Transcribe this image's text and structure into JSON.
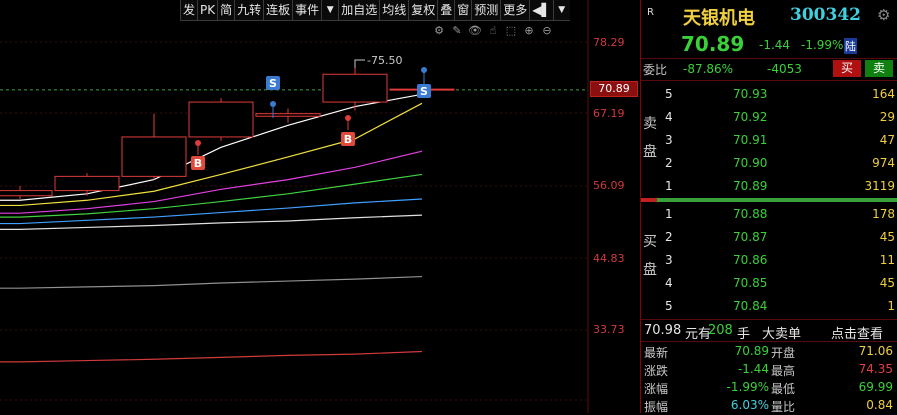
{
  "toolbar": {
    "items": [
      "发",
      "PK",
      "简",
      "九转",
      "连板",
      "事件",
      "▼",
      "加自选",
      "均线",
      "复权",
      "叠",
      "窗",
      "预测",
      "更多",
      "◀▌",
      "▼"
    ]
  },
  "chart": {
    "y_ticks": [
      "78.29",
      "67.19",
      "56.09",
      "44.83",
      "33.73"
    ],
    "current_price": "70.89",
    "high_label": "75.50",
    "markers": {
      "buy": "B",
      "sell": "S"
    },
    "tools": [
      "⚙",
      "✎",
      "👁",
      "☝",
      "⬚",
      "⊕",
      "⊖"
    ]
  },
  "chart_data": {
    "type": "candlestick",
    "y_axis_ticks": [
      78.29,
      67.19,
      56.09,
      44.83,
      33.73
    ],
    "current_price": 70.89,
    "annotated_high": 75.5,
    "candles": [
      {
        "o": 54.5,
        "c": 55.3,
        "h": 56.0,
        "l": 54.0
      },
      {
        "o": 55.3,
        "c": 57.5,
        "h": 58.0,
        "l": 54.5
      },
      {
        "o": 57.5,
        "c": 63.6,
        "h": 67.2,
        "l": 57.0
      },
      {
        "o": 63.6,
        "c": 69.0,
        "h": 69.6,
        "l": 63.0
      },
      {
        "o": 66.8,
        "c": 67.2,
        "h": 68.0,
        "l": 65.8
      },
      {
        "o": 69.0,
        "c": 73.3,
        "h": 75.5,
        "l": 67.7
      },
      {
        "o": 70.9,
        "c": 71.0,
        "h": 71.2,
        "l": 70.7
      }
    ],
    "moving_averages": [
      {
        "color": "#ffffff",
        "values": [
          53.8,
          54.8,
          57.0,
          62.0,
          65.4,
          68.3,
          70.2
        ]
      },
      {
        "color": "#f0e040",
        "values": [
          53.0,
          53.8,
          55.2,
          57.8,
          60.5,
          63.3,
          68.8
        ]
      },
      {
        "color": "#e040e0",
        "values": [
          51.8,
          52.5,
          53.6,
          55.5,
          57.0,
          58.9,
          61.4
        ]
      },
      {
        "color": "#40d040",
        "values": [
          51.2,
          51.7,
          52.5,
          53.6,
          54.8,
          56.3,
          57.8
        ]
      },
      {
        "color": "#40a0ff",
        "values": [
          50.2,
          50.7,
          51.2,
          51.9,
          52.6,
          53.4,
          54.0
        ]
      },
      {
        "color": "#e0e0e0",
        "values": [
          49.3,
          49.6,
          49.9,
          50.3,
          50.6,
          51.1,
          51.5
        ]
      },
      {
        "color": "#909090",
        "values": [
          40.2,
          40.4,
          40.6,
          41.0,
          41.3,
          41.6,
          42.0
        ]
      },
      {
        "color": "#d03a3a",
        "values": [
          28.8,
          29.0,
          29.2,
          29.5,
          29.8,
          30.0,
          30.4
        ]
      }
    ]
  },
  "stock": {
    "badge": "R",
    "name": "天银机电",
    "code": "300342",
    "price": "70.89",
    "change": "-1.44",
    "change_pct": "-1.99%",
    "market_tag": "陆"
  },
  "webi": {
    "label": "委比",
    "ratio": "-87.86%",
    "diff": "-4053",
    "buy": "买",
    "sell": "卖"
  },
  "orderbook": {
    "sell_label": [
      "卖",
      "盘"
    ],
    "buy_label": [
      "买",
      "盘"
    ],
    "asks": [
      {
        "n": "5",
        "p": "70.93",
        "q": "164"
      },
      {
        "n": "4",
        "p": "70.92",
        "q": "29"
      },
      {
        "n": "3",
        "p": "70.91",
        "q": "47"
      },
      {
        "n": "2",
        "p": "70.90",
        "q": "974"
      },
      {
        "n": "1",
        "p": "70.89",
        "q": "3119"
      }
    ],
    "bids": [
      {
        "n": "1",
        "p": "70.88",
        "q": "178"
      },
      {
        "n": "2",
        "p": "70.87",
        "q": "45"
      },
      {
        "n": "3",
        "p": "70.86",
        "q": "11"
      },
      {
        "n": "4",
        "p": "70.85",
        "q": "45"
      },
      {
        "n": "5",
        "p": "70.84",
        "q": "1"
      }
    ]
  },
  "trade": {
    "price": "70.98",
    "unit1": "元有",
    "vol": "208",
    "unit2": "手",
    "big": "大卖单",
    "link": "点击查看"
  },
  "stats": [
    {
      "l1": "最新",
      "v1": "70.89",
      "c1": "#3ad03a",
      "l2": "开盘",
      "v2": "71.06",
      "c2": "#f0d040"
    },
    {
      "l1": "涨跌",
      "v1": "-1.44",
      "c1": "#3ad03a",
      "l2": "最高",
      "v2": "74.35",
      "c2": "#e04040"
    },
    {
      "l1": "涨幅",
      "v1": "-1.99%",
      "c1": "#3ad03a",
      "l2": "最低",
      "v2": "69.99",
      "c2": "#3ad03a"
    },
    {
      "l1": "振幅",
      "v1": "6.03%",
      "c1": "#40d0e0",
      "l2": "量比",
      "v2": "0.84",
      "c2": "#f0d040"
    }
  ]
}
